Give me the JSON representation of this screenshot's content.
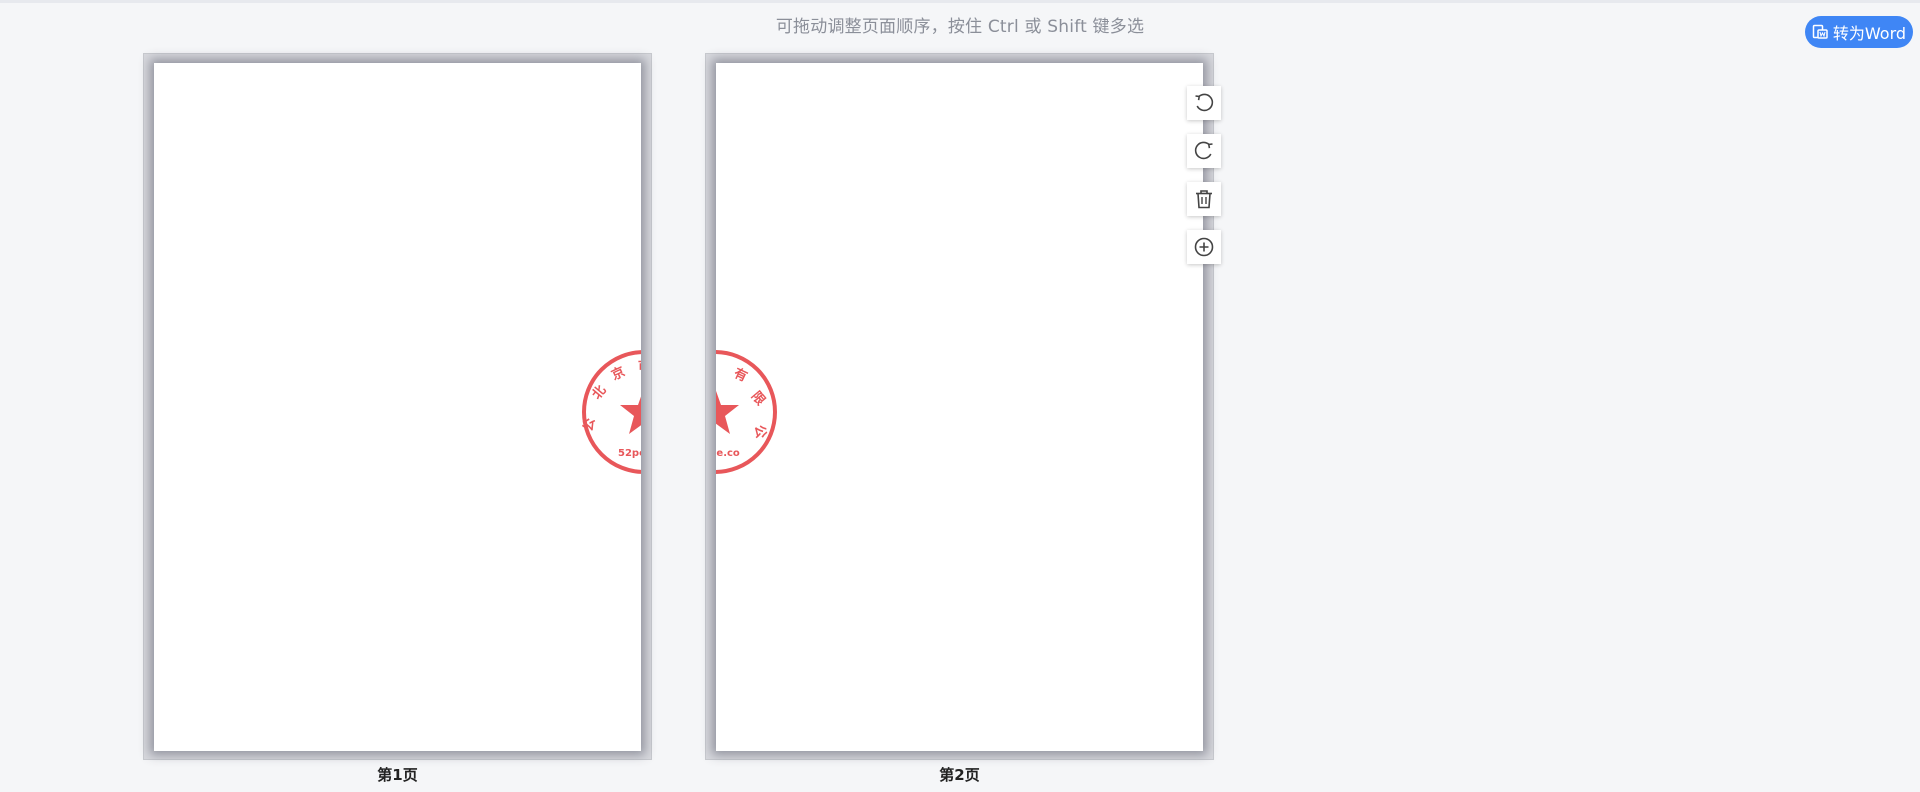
{
  "header": {
    "hint": "可拖动调整页面顺序，按住 Ctrl 或 Shift 键多选"
  },
  "actions": {
    "convert_label": "转为Word"
  },
  "pages": [
    {
      "label": "第1页",
      "seal_text_visible": "52po"
    },
    {
      "label": "第2页",
      "seal_text_visible": "ie.co"
    }
  ],
  "toolbar": {
    "tools": [
      {
        "name": "rotate-left",
        "icon": "rotate-left-icon"
      },
      {
        "name": "rotate-right",
        "icon": "rotate-right-icon"
      },
      {
        "name": "delete",
        "icon": "trash-icon"
      },
      {
        "name": "add",
        "icon": "plus-circle-icon"
      }
    ]
  },
  "colors": {
    "accent": "#3f86f5",
    "seal": "#e8575a",
    "background": "#f5f6f8"
  }
}
